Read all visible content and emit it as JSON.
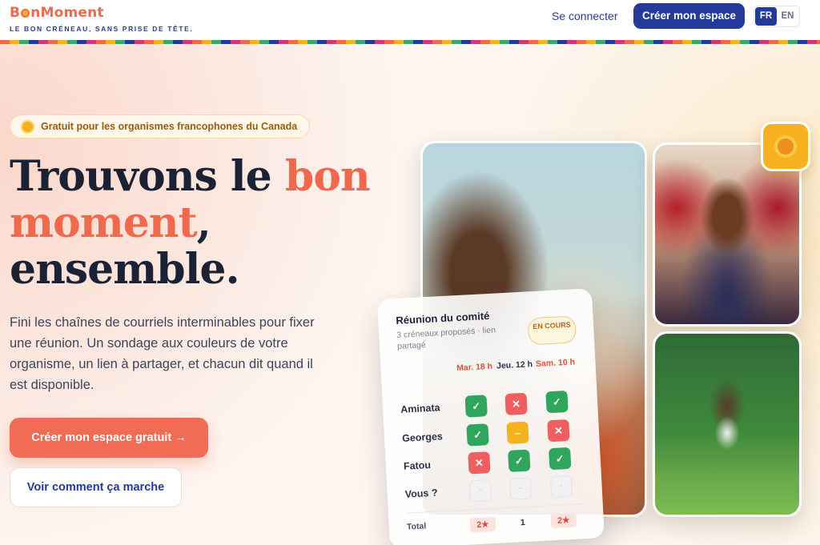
{
  "brand": {
    "logo_prefix": "B",
    "logo_suffix": "nMoment",
    "tagline": "LE BON CRÉNEAU, SANS PRISE DE TÊTE."
  },
  "nav": {
    "login": "Se connecter",
    "create_space": "Créer mon espace",
    "lang_fr": "FR",
    "lang_en": "EN"
  },
  "hero": {
    "badge": "Gratuit pour les organismes francophones du Canada",
    "title_part1": "Trouvons le ",
    "title_accent1": "bon",
    "title_accent2": "moment",
    "title_part2": ",",
    "title_part3": "ensemble.",
    "lead": "Fini les chaînes de courriels interminables pour fixer une réunion. Un sondage aux couleurs de votre organisme, un lien à partager, et chacun dit quand il est disponible.",
    "primary_cta": "Créer mon espace gratuit →",
    "secondary_cta": "Voir comment ça marche"
  },
  "poll": {
    "title": "Réunion du comité",
    "subtitle": "3 créneaux proposés · lien partagé",
    "status": "EN COURS",
    "columns": [
      {
        "label": "Mar. 18 h",
        "color": "#e3503a"
      },
      {
        "label": "Jeu. 12 h",
        "color": "#2a3048"
      },
      {
        "label": "Sam. 10 h",
        "color": "#e3503a"
      }
    ],
    "rows": [
      {
        "name": "Aminata",
        "answers": [
          "yes",
          "no",
          "yes"
        ]
      },
      {
        "name": "Georges",
        "answers": [
          "yes",
          "maybe",
          "no"
        ]
      },
      {
        "name": "Fatou",
        "answers": [
          "no",
          "yes",
          "yes"
        ]
      },
      {
        "name": "Vous ?",
        "answers": [
          "empty",
          "empty",
          "empty"
        ]
      }
    ],
    "total_label": "Total",
    "totals": [
      "2★",
      "1",
      "2★"
    ],
    "symbols": {
      "yes": "✓",
      "no": "✕",
      "maybe": "–",
      "empty": "·"
    }
  },
  "colors": {
    "accent": "#ef6a4c",
    "brand_blue": "#233a9a",
    "sun": "#f7b11e"
  }
}
